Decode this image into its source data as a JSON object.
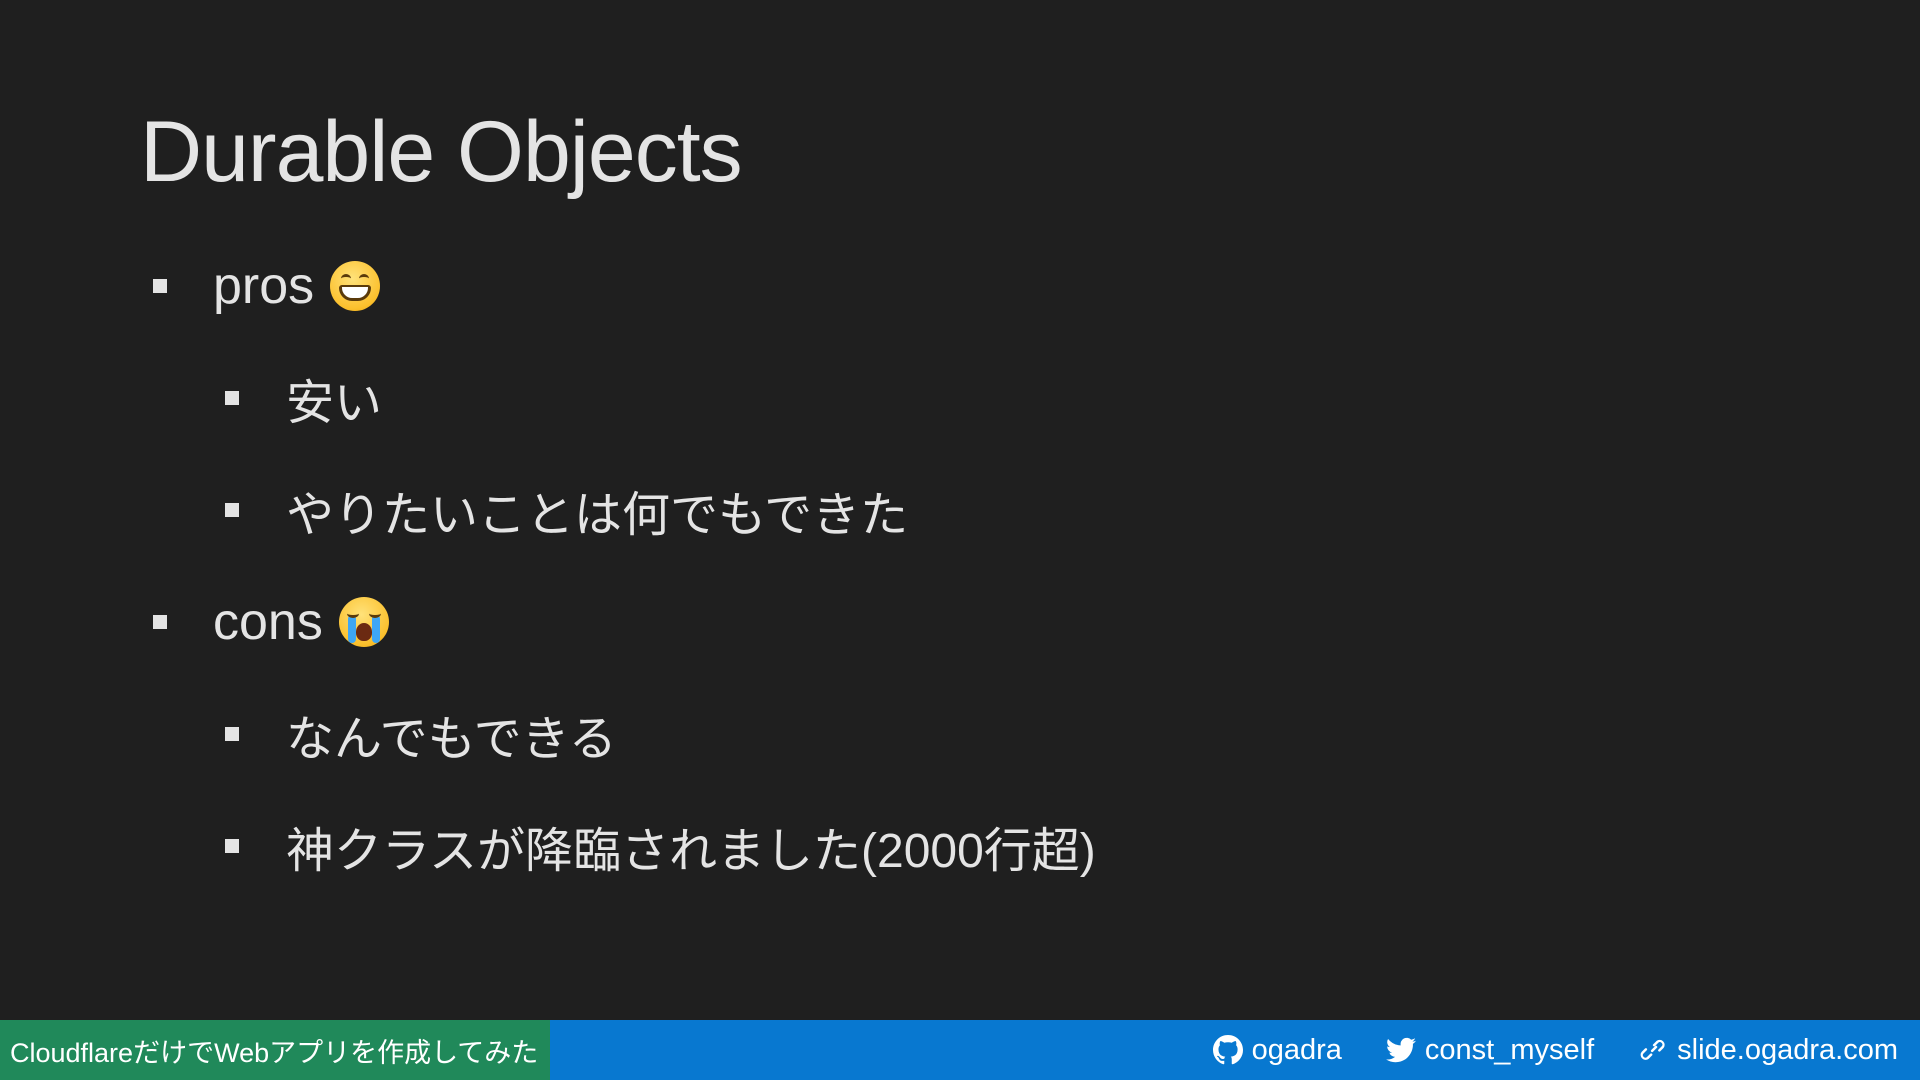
{
  "slide": {
    "title": "Durable Objects",
    "bullets": [
      {
        "label": "pros",
        "icon": "grinning-face-emoji"
      },
      {
        "label": "安い"
      },
      {
        "label": "やりたいことは何でもできた"
      },
      {
        "label": "cons",
        "icon": "loudly-crying-face-emoji"
      },
      {
        "label": "なんでもできる"
      },
      {
        "label": "神クラスが降臨されました(2000行超)"
      }
    ]
  },
  "footer": {
    "deck_title": "CloudflareだけでWebアプリを作成してみた",
    "github": {
      "icon": "github-icon",
      "handle": "ogadra"
    },
    "twitter": {
      "icon": "twitter-icon",
      "handle": "const_myself"
    },
    "website": {
      "icon": "link-icon",
      "url": "slide.ogadra.com"
    }
  },
  "colors": {
    "background": "#1f1f1f",
    "text": "#e4e4e4",
    "footer_bar": "#0878d0",
    "footer_title_bg": "#20895a"
  }
}
